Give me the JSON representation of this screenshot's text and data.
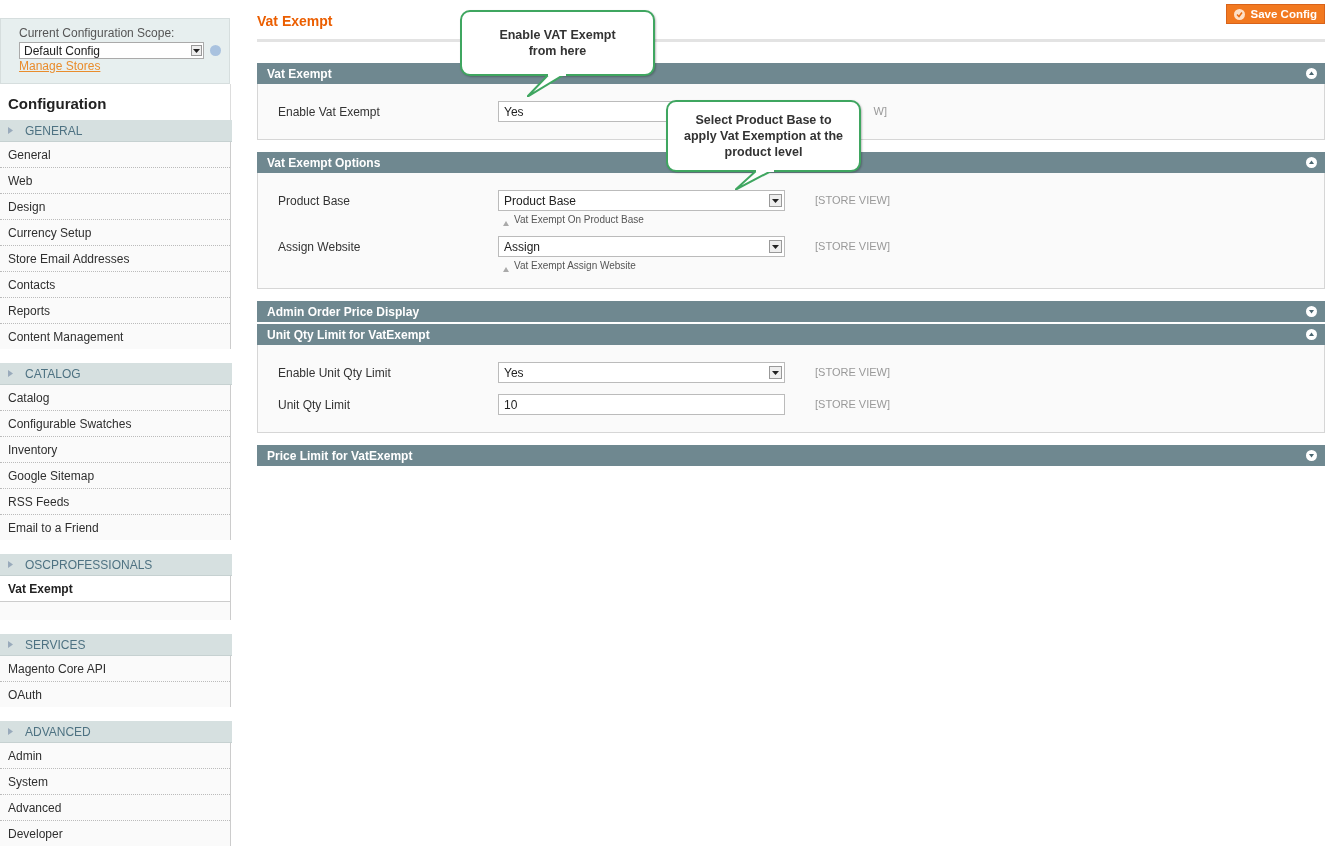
{
  "scope": {
    "label": "Current Configuration Scope:",
    "value": "Default Config",
    "link": "Manage Stores"
  },
  "sidebar": {
    "title": "Configuration",
    "groups": [
      {
        "label": "GENERAL",
        "items": [
          {
            "label": "General",
            "selected": false
          },
          {
            "label": "Web",
            "selected": false
          },
          {
            "label": "Design",
            "selected": false
          },
          {
            "label": "Currency Setup",
            "selected": false
          },
          {
            "label": "Store Email Addresses",
            "selected": false
          },
          {
            "label": "Contacts",
            "selected": false
          },
          {
            "label": "Reports",
            "selected": false
          },
          {
            "label": "Content Management",
            "selected": false
          }
        ]
      },
      {
        "label": "CATALOG",
        "items": [
          {
            "label": "Catalog",
            "selected": false
          },
          {
            "label": "Configurable Swatches",
            "selected": false
          },
          {
            "label": "Inventory",
            "selected": false
          },
          {
            "label": "Google Sitemap",
            "selected": false
          },
          {
            "label": "RSS Feeds",
            "selected": false
          },
          {
            "label": "Email to a Friend",
            "selected": false
          }
        ]
      },
      {
        "label": "OSCPROFESSIONALS",
        "items": [
          {
            "label": "Vat Exempt",
            "selected": true
          }
        ]
      },
      {
        "label": "SERVICES",
        "items": [
          {
            "label": "Magento Core API",
            "selected": false
          },
          {
            "label": "OAuth",
            "selected": false
          }
        ]
      },
      {
        "label": "ADVANCED",
        "items": [
          {
            "label": "Admin",
            "selected": false
          },
          {
            "label": "System",
            "selected": false
          },
          {
            "label": "Advanced",
            "selected": false
          },
          {
            "label": "Developer",
            "selected": false
          }
        ]
      }
    ]
  },
  "page": {
    "title": "Vat Exempt",
    "save_button": "Save Config"
  },
  "sections": [
    {
      "title": "Vat Exempt",
      "expanded": true,
      "rows": [
        {
          "kind": "text",
          "label": "Enable Vat Exempt",
          "value": "Yes",
          "scope": "W]"
        }
      ]
    },
    {
      "title": "Vat Exempt Options",
      "expanded": true,
      "rows": [
        {
          "kind": "select",
          "label": "Product Base",
          "value": "Product Base",
          "hint": "Vat Exempt On Product Base",
          "scope": "[STORE VIEW]"
        },
        {
          "kind": "select",
          "label": "Assign Website",
          "value": "Assign",
          "hint": "Vat Exempt Assign Website",
          "scope": "[STORE VIEW]"
        }
      ]
    },
    {
      "title": "Admin Order Price Display",
      "expanded": false
    },
    {
      "title": "Unit Qty Limit for VatExempt",
      "expanded": true,
      "rows": [
        {
          "kind": "select",
          "label": "Enable Unit Qty Limit",
          "value": "Yes",
          "scope": "[STORE VIEW]"
        },
        {
          "kind": "text",
          "label": "Unit Qty Limit",
          "value": "10",
          "scope": "[STORE VIEW]"
        }
      ]
    },
    {
      "title": "Price Limit for VatExempt",
      "expanded": false
    }
  ],
  "callouts": [
    {
      "text": "Enable VAT Exempt from here"
    },
    {
      "text": "Select Product Base to apply Vat Exemption at the product level"
    }
  ]
}
